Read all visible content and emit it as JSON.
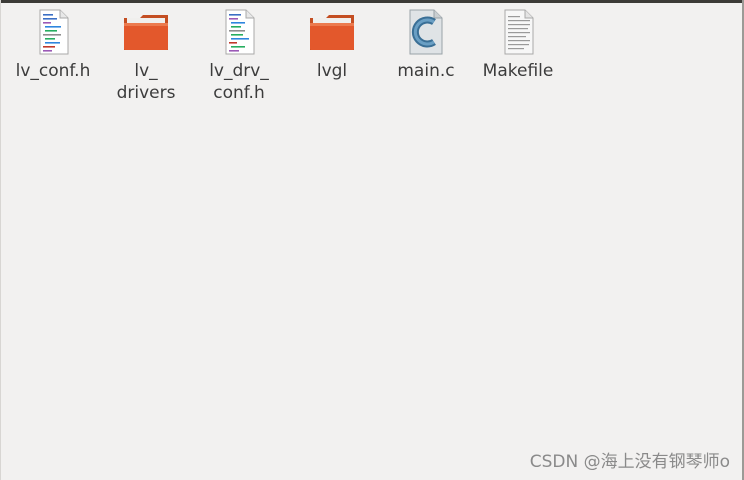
{
  "files": [
    {
      "name": "lv_conf.h",
      "icon": "text-file-icon"
    },
    {
      "name": "lv_\ndrivers",
      "icon": "folder-icon"
    },
    {
      "name": "lv_drv_\nconf.h",
      "icon": "text-file-icon"
    },
    {
      "name": "lvgl",
      "icon": "folder-icon"
    },
    {
      "name": "main.c",
      "icon": "c-source-file-icon"
    },
    {
      "name": "Makefile",
      "icon": "document-file-icon"
    }
  ],
  "colors": {
    "background": "#f2f1f0",
    "folder": "#e3582c",
    "label": "#3c3c3c"
  },
  "watermark": "CSDN @海上没有钢琴师o"
}
